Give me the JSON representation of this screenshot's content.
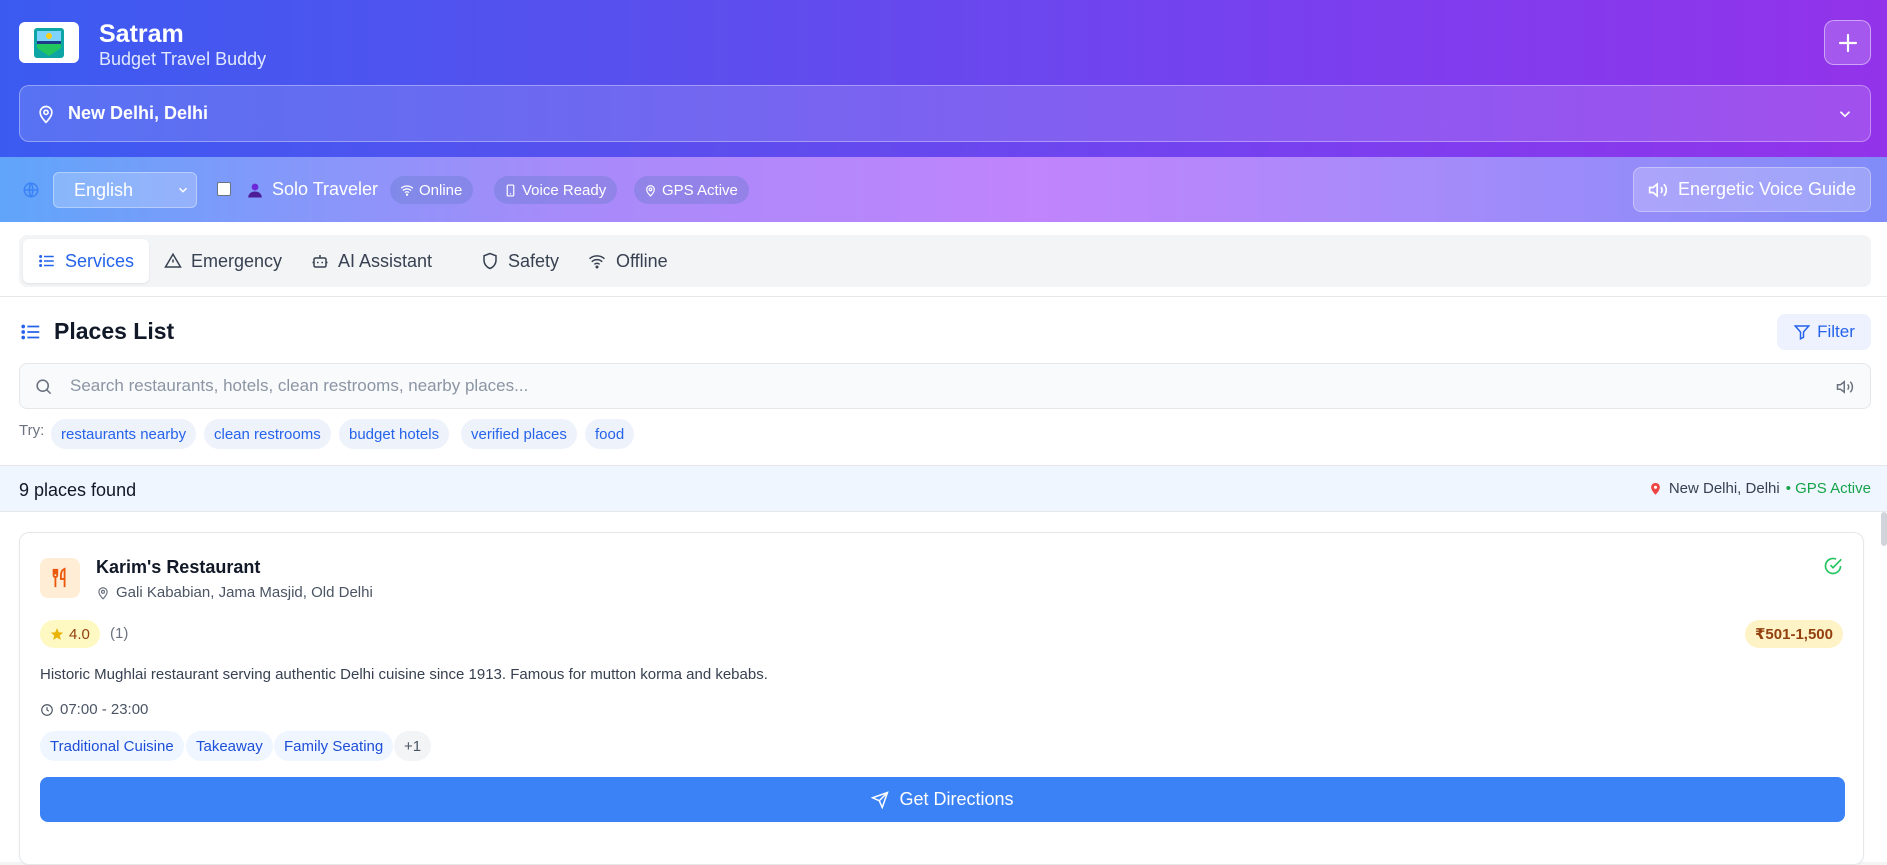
{
  "app": {
    "title": "Satram",
    "subtitle": "Budget Travel Buddy",
    "logo_icon": "shield-logo-icon",
    "add_icon": "plus-icon"
  },
  "location": {
    "value": "New Delhi, Delhi"
  },
  "status": {
    "language": "English",
    "solo_label": "Solo Traveler",
    "pills": [
      "Online",
      "Voice Ready",
      "GPS Active"
    ],
    "voice_guide_label": "Energetic Voice Guide"
  },
  "tabs": [
    {
      "label": "Services",
      "icon": "list-icon",
      "active": true
    },
    {
      "label": "Emergency",
      "icon": "alert-triangle-icon",
      "active": false
    },
    {
      "label": "AI Assistant",
      "icon": "bot-icon",
      "active": false
    },
    {
      "label": "Safety",
      "icon": "shield-icon",
      "active": false
    },
    {
      "label": "Offline",
      "icon": "wifi-icon",
      "active": false
    }
  ],
  "places": {
    "title": "Places List",
    "filter_label": "Filter",
    "search_placeholder": "Search restaurants, hotels, clean restrooms, nearby places...",
    "try_label": "Try:",
    "suggestions": [
      "restaurants nearby",
      "clean restrooms",
      "budget hotels",
      "verified places",
      "food"
    ],
    "count_text": "9 places found",
    "location_text": "New Delhi, Delhi",
    "gps_text": "• GPS Active"
  },
  "cards": [
    {
      "name": "Karim's Restaurant",
      "address": "Gali Kababian, Jama Masjid, Old Delhi",
      "rating": "4.0",
      "rating_count": "(1)",
      "price": "₹501-1,500",
      "description": "Historic Mughlai restaurant serving authentic Delhi cuisine since 1913. Famous for mutton korma and kebabs.",
      "hours": "07:00 - 23:00",
      "tags": [
        "Traditional Cuisine",
        "Takeaway",
        "Family Seating",
        "+1"
      ],
      "action_label": "Get Directions"
    }
  ],
  "colors": {
    "accent": "#2563eb",
    "button": "#3b82f6",
    "success": "#16a34a"
  }
}
